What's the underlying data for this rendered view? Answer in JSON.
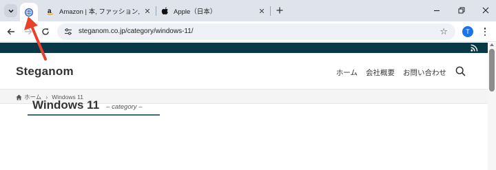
{
  "tabs": [
    {
      "title": "Amazon | 本, ファッション, 家電から",
      "favicon": "amazon-icon"
    },
    {
      "title": "Apple（日本）",
      "favicon": "apple-icon"
    }
  ],
  "pinned_tab": {
    "favicon": "globe-icon"
  },
  "toolbar": {
    "url": "steganom.co.jp/category/windows-11/",
    "profile_initial": "T"
  },
  "site": {
    "logo": "Steganom",
    "nav": [
      "ホーム",
      "会社概要",
      "お問い合わせ"
    ],
    "breadcrumb": {
      "home": "ホーム",
      "current": "Windows 11"
    },
    "archive_title": "Windows 11",
    "archive_subtitle": "– category –"
  },
  "colors": {
    "tabstrip": "#dfe3eb",
    "topbar": "#0b3846",
    "annotation_arrow": "#e8412c",
    "profile": "#1a73e8"
  }
}
